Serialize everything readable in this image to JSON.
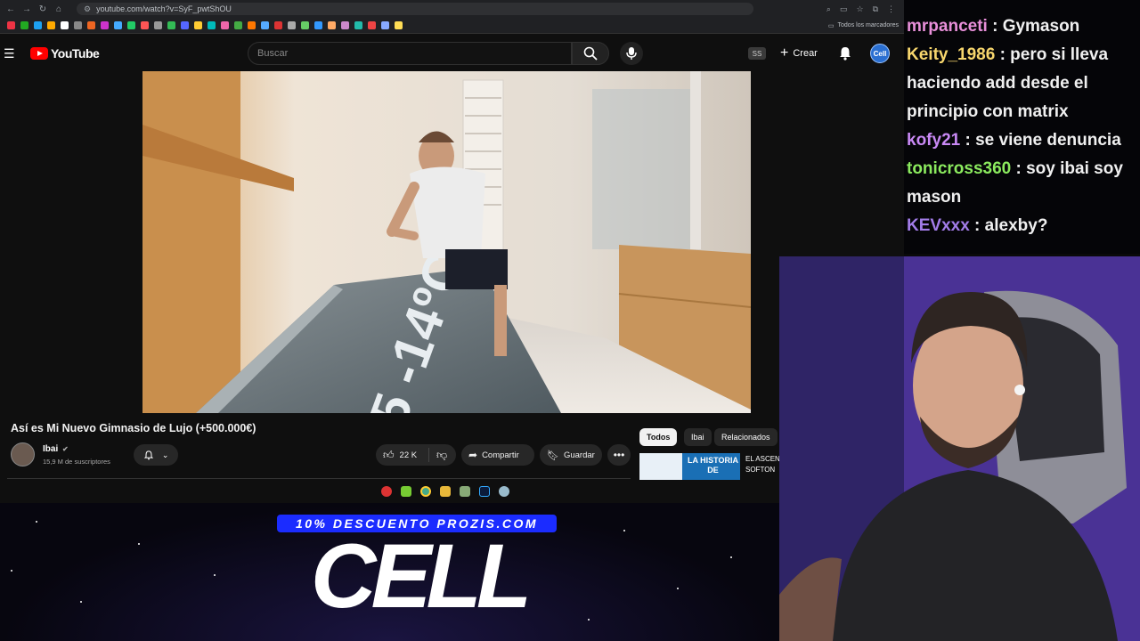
{
  "browser": {
    "url": "youtube.com/watch?v=SyF_pwtShOU",
    "bookmarks_folder_label": "Todos los marcadores",
    "bookmark_colors": [
      "#e34",
      "#2a2",
      "#1da1f2",
      "#fa0",
      "#fff",
      "#888",
      "#e62",
      "#c3c",
      "#4af",
      "#2c6",
      "#f55",
      "#999",
      "#3b5",
      "#56f",
      "#fc3",
      "#0bb",
      "#e6a",
      "#4a4",
      "#f70",
      "#5af",
      "#d33",
      "#aaa",
      "#6c6",
      "#39f",
      "#fa6",
      "#c8c",
      "#2ba",
      "#e44",
      "#8af",
      "#fd5"
    ]
  },
  "youtube": {
    "logo_text": "YouTube",
    "search_placeholder": "Buscar",
    "ss_badge": "SS",
    "create_label": "Crear",
    "avatar_label": "Cell"
  },
  "video": {
    "title": "Así es Mi Nuevo Gimnasio de Lujo (+500.000€)",
    "overlay_text": "5 -14ºC",
    "channel_name": "Ibai",
    "subscribers": "15,9 M de suscriptores",
    "likes": "22 K",
    "share_label": "Compartir",
    "save_label": "Guardar"
  },
  "recommendations": {
    "chips": [
      "Todos",
      "Ibai",
      "Relacionados"
    ],
    "thumb_text_line1": "LA HISTORIA",
    "thumb_text_line2": "DE",
    "title_line1": "EL ASCEN",
    "title_line2": "SOFTON"
  },
  "chat": {
    "messages": [
      {
        "user": "mrpanceti",
        "color": "#e88fd9",
        "text": ": Gymason"
      },
      {
        "user": "Keity_1986",
        "color": "#f7d66d",
        "text": ": pero si lleva haciendo add desde el principio con matrix"
      },
      {
        "user": "kofy21",
        "color": "#c989f5",
        "text": ": se viene denuncia"
      },
      {
        "user": "tonicross360",
        "color": "#8bea5e",
        "text": ": soy ibai soy mason"
      },
      {
        "user": "KEVxxx",
        "color": "#a27ce8",
        "text": ": alexby?"
      }
    ]
  },
  "overlay": {
    "promo": "10% DESCUENTO PROZIS.COM",
    "brand": "CELL"
  }
}
